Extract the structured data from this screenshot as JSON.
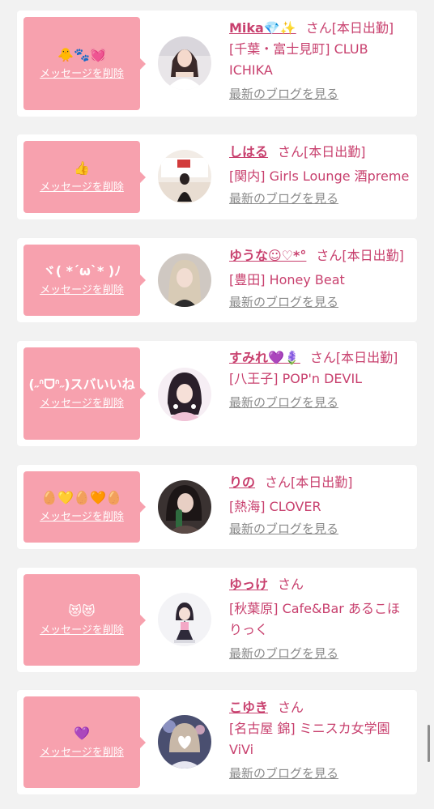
{
  "colors": {
    "bubble": "#f7a1ae",
    "accent": "#c8406e",
    "link_gray": "#8a8a8a",
    "background": "#f2f2f2",
    "card": "#ffffff"
  },
  "delete_label": "メッセージを削除",
  "blog_label": "最新のブログを見る",
  "entries": [
    {
      "message": "🐥🐾💓",
      "name": "Mika💎✨",
      "suffix": "さん[本日出勤]",
      "location": "[千葉・富士見町] CLUB ICHIKA",
      "avatar_icon": "woman-white-top-avatar"
    },
    {
      "message": "👍",
      "name": "しはる",
      "suffix": "さん[本日出勤]",
      "location": "[関内] Girls Lounge 酒preme",
      "avatar_icon": "woman-dark-dress-avatar"
    },
    {
      "message": "ヾ( *´ω`* )ﾉ",
      "name": "ゆうな☺︎♡*°",
      "suffix": "さん[本日出勤]",
      "location": "[豊田] Honey Beat",
      "avatar_icon": "woman-blonde-avatar"
    },
    {
      "message": "(˶ᐢᗜᐢ˶)スバいいね",
      "name": "すみれ💜🪻",
      "suffix": "さん[本日出勤]",
      "location": "[八王子] POP'n DEVIL",
      "avatar_icon": "woman-idol-outfit-avatar"
    },
    {
      "message": "🥚💛🥚🧡🥚",
      "name": "りの",
      "suffix": "さん[本日出勤]",
      "location": "[熱海] CLOVER",
      "avatar_icon": "woman-with-bottle-avatar"
    },
    {
      "message": "😻😻",
      "name": "ゆっけ",
      "suffix": "さん",
      "location": "[秋葉原] Cafe&Bar あるこほりっく",
      "avatar_icon": "woman-maid-outfit-avatar"
    },
    {
      "message": "💜",
      "name": "こゆき",
      "suffix": "さん",
      "location": "[名古屋 錦] ミニスカ女学園 ViVi",
      "avatar_icon": "woman-heart-face-avatar"
    }
  ]
}
